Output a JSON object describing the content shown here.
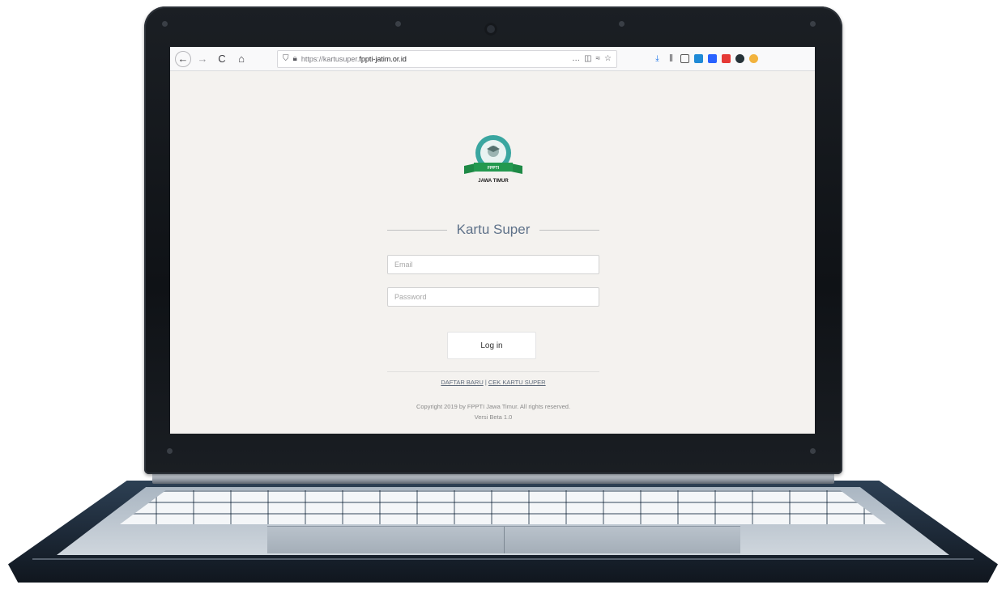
{
  "browser": {
    "url_prefix": "https://kartusuper.",
    "url_domain": "fppti-jatim.or.id",
    "more_icon": "…",
    "back_icon": "←",
    "forward_icon": "→",
    "reload_icon": "C",
    "home_icon": "⌂"
  },
  "logo": {
    "ribbon_text": "FPPTI",
    "caption": "JAWA TIMUR"
  },
  "login": {
    "title": "Kartu Super",
    "email_placeholder": "Email",
    "password_placeholder": "Password",
    "submit_label": "Log in",
    "register_link": "DAFTAR BARU",
    "link_separator": " | ",
    "check_card_link": "CEK KARTU SUPER"
  },
  "footer": {
    "copyright": "Copyright 2019 by FPPTI Jawa Timur. All rights reserved.",
    "version": "Versi Beta 1.0"
  },
  "colors": {
    "title": "#5e7189",
    "logo_teal": "#3aa6a0",
    "logo_green": "#1e8a46",
    "page_background": "#f4f2ef"
  }
}
